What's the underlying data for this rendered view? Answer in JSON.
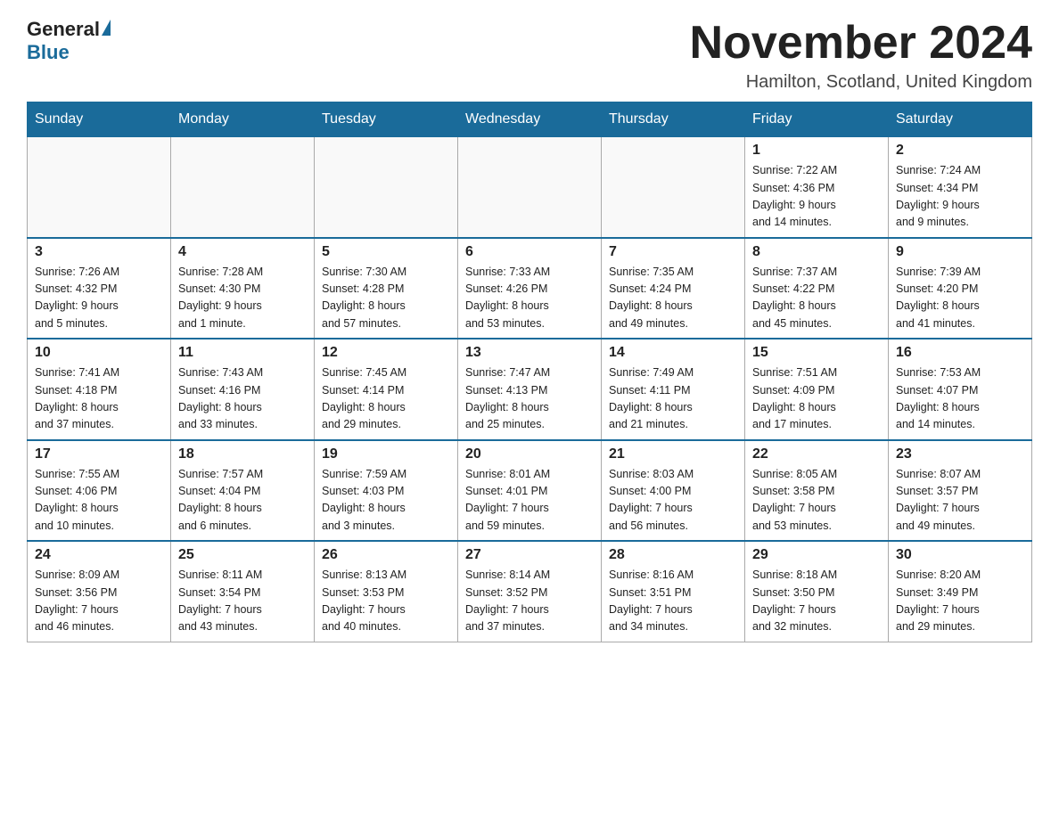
{
  "header": {
    "logo_general": "General",
    "logo_blue": "Blue",
    "month_title": "November 2024",
    "location": "Hamilton, Scotland, United Kingdom"
  },
  "weekdays": [
    "Sunday",
    "Monday",
    "Tuesday",
    "Wednesday",
    "Thursday",
    "Friday",
    "Saturday"
  ],
  "weeks": [
    [
      {
        "day": "",
        "info": ""
      },
      {
        "day": "",
        "info": ""
      },
      {
        "day": "",
        "info": ""
      },
      {
        "day": "",
        "info": ""
      },
      {
        "day": "",
        "info": ""
      },
      {
        "day": "1",
        "info": "Sunrise: 7:22 AM\nSunset: 4:36 PM\nDaylight: 9 hours\nand 14 minutes."
      },
      {
        "day": "2",
        "info": "Sunrise: 7:24 AM\nSunset: 4:34 PM\nDaylight: 9 hours\nand 9 minutes."
      }
    ],
    [
      {
        "day": "3",
        "info": "Sunrise: 7:26 AM\nSunset: 4:32 PM\nDaylight: 9 hours\nand 5 minutes."
      },
      {
        "day": "4",
        "info": "Sunrise: 7:28 AM\nSunset: 4:30 PM\nDaylight: 9 hours\nand 1 minute."
      },
      {
        "day": "5",
        "info": "Sunrise: 7:30 AM\nSunset: 4:28 PM\nDaylight: 8 hours\nand 57 minutes."
      },
      {
        "day": "6",
        "info": "Sunrise: 7:33 AM\nSunset: 4:26 PM\nDaylight: 8 hours\nand 53 minutes."
      },
      {
        "day": "7",
        "info": "Sunrise: 7:35 AM\nSunset: 4:24 PM\nDaylight: 8 hours\nand 49 minutes."
      },
      {
        "day": "8",
        "info": "Sunrise: 7:37 AM\nSunset: 4:22 PM\nDaylight: 8 hours\nand 45 minutes."
      },
      {
        "day": "9",
        "info": "Sunrise: 7:39 AM\nSunset: 4:20 PM\nDaylight: 8 hours\nand 41 minutes."
      }
    ],
    [
      {
        "day": "10",
        "info": "Sunrise: 7:41 AM\nSunset: 4:18 PM\nDaylight: 8 hours\nand 37 minutes."
      },
      {
        "day": "11",
        "info": "Sunrise: 7:43 AM\nSunset: 4:16 PM\nDaylight: 8 hours\nand 33 minutes."
      },
      {
        "day": "12",
        "info": "Sunrise: 7:45 AM\nSunset: 4:14 PM\nDaylight: 8 hours\nand 29 minutes."
      },
      {
        "day": "13",
        "info": "Sunrise: 7:47 AM\nSunset: 4:13 PM\nDaylight: 8 hours\nand 25 minutes."
      },
      {
        "day": "14",
        "info": "Sunrise: 7:49 AM\nSunset: 4:11 PM\nDaylight: 8 hours\nand 21 minutes."
      },
      {
        "day": "15",
        "info": "Sunrise: 7:51 AM\nSunset: 4:09 PM\nDaylight: 8 hours\nand 17 minutes."
      },
      {
        "day": "16",
        "info": "Sunrise: 7:53 AM\nSunset: 4:07 PM\nDaylight: 8 hours\nand 14 minutes."
      }
    ],
    [
      {
        "day": "17",
        "info": "Sunrise: 7:55 AM\nSunset: 4:06 PM\nDaylight: 8 hours\nand 10 minutes."
      },
      {
        "day": "18",
        "info": "Sunrise: 7:57 AM\nSunset: 4:04 PM\nDaylight: 8 hours\nand 6 minutes."
      },
      {
        "day": "19",
        "info": "Sunrise: 7:59 AM\nSunset: 4:03 PM\nDaylight: 8 hours\nand 3 minutes."
      },
      {
        "day": "20",
        "info": "Sunrise: 8:01 AM\nSunset: 4:01 PM\nDaylight: 7 hours\nand 59 minutes."
      },
      {
        "day": "21",
        "info": "Sunrise: 8:03 AM\nSunset: 4:00 PM\nDaylight: 7 hours\nand 56 minutes."
      },
      {
        "day": "22",
        "info": "Sunrise: 8:05 AM\nSunset: 3:58 PM\nDaylight: 7 hours\nand 53 minutes."
      },
      {
        "day": "23",
        "info": "Sunrise: 8:07 AM\nSunset: 3:57 PM\nDaylight: 7 hours\nand 49 minutes."
      }
    ],
    [
      {
        "day": "24",
        "info": "Sunrise: 8:09 AM\nSunset: 3:56 PM\nDaylight: 7 hours\nand 46 minutes."
      },
      {
        "day": "25",
        "info": "Sunrise: 8:11 AM\nSunset: 3:54 PM\nDaylight: 7 hours\nand 43 minutes."
      },
      {
        "day": "26",
        "info": "Sunrise: 8:13 AM\nSunset: 3:53 PM\nDaylight: 7 hours\nand 40 minutes."
      },
      {
        "day": "27",
        "info": "Sunrise: 8:14 AM\nSunset: 3:52 PM\nDaylight: 7 hours\nand 37 minutes."
      },
      {
        "day": "28",
        "info": "Sunrise: 8:16 AM\nSunset: 3:51 PM\nDaylight: 7 hours\nand 34 minutes."
      },
      {
        "day": "29",
        "info": "Sunrise: 8:18 AM\nSunset: 3:50 PM\nDaylight: 7 hours\nand 32 minutes."
      },
      {
        "day": "30",
        "info": "Sunrise: 8:20 AM\nSunset: 3:49 PM\nDaylight: 7 hours\nand 29 minutes."
      }
    ]
  ]
}
